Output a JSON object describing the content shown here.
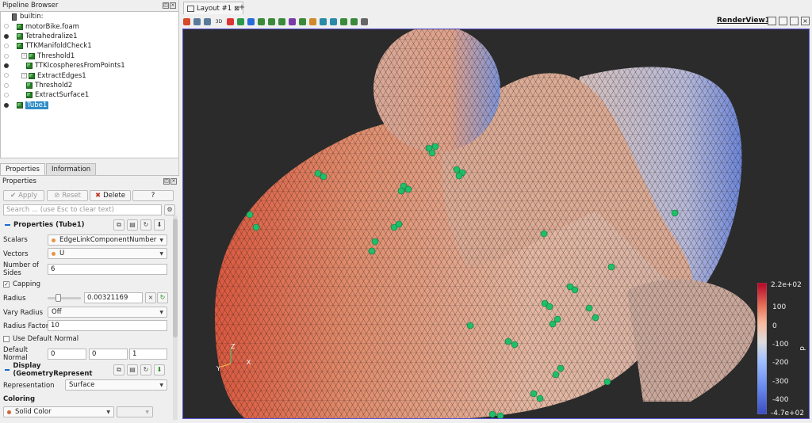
{
  "pipeline_browser": {
    "title": "Pipeline Browser",
    "items": [
      {
        "label": "builtin:",
        "level": 0,
        "kind": "server",
        "eye": "none",
        "expand": ""
      },
      {
        "label": "motorBike.foam",
        "level": 1,
        "kind": "source",
        "eye": "off",
        "expand": ""
      },
      {
        "label": "Tetrahedralize1",
        "level": 1,
        "kind": "source",
        "eye": "on",
        "expand": ""
      },
      {
        "label": "TTKManifoldCheck1",
        "level": 1,
        "kind": "source",
        "eye": "off",
        "expand": ""
      },
      {
        "label": "Threshold1",
        "level": 2,
        "kind": "source",
        "eye": "off",
        "expand": "-"
      },
      {
        "label": "TTKIcospheresFromPoints1",
        "level": 3,
        "kind": "source",
        "eye": "on",
        "expand": ""
      },
      {
        "label": "ExtractEdges1",
        "level": 2,
        "kind": "source",
        "eye": "off",
        "expand": "-"
      },
      {
        "label": "Threshold2",
        "level": 3,
        "kind": "source",
        "eye": "off",
        "expand": ""
      },
      {
        "label": "ExtractSurface1",
        "level": 3,
        "kind": "source",
        "eye": "off",
        "expand": ""
      },
      {
        "label": "Tube1",
        "level": 1,
        "kind": "source",
        "eye": "on",
        "expand": "",
        "selected": true
      }
    ]
  },
  "tabs": [
    {
      "label": "Properties",
      "active": true
    },
    {
      "label": "Information",
      "active": false
    }
  ],
  "properties": {
    "title": "Properties",
    "apply_label": "Apply",
    "reset_label": "Reset",
    "delete_label": "Delete",
    "help_label": "?",
    "search_placeholder": "Search ... (use Esc to clear text)",
    "section_properties": "Properties (Tube1)",
    "scalars_label": "Scalars",
    "scalars_value": "EdgeLinkComponentNumber",
    "vectors_label": "Vectors",
    "vectors_value": "U",
    "sides_label": "Number of Sides",
    "sides_value": "6",
    "capping_label": "Capping",
    "capping_checked": true,
    "radius_label": "Radius",
    "radius_value": "0.00321169",
    "vary_radius_label": "Vary Radius",
    "vary_radius_value": "Off",
    "radius_factor_label": "Radius Factor",
    "radius_factor_value": "10",
    "use_default_normal_label": "Use Default Normal",
    "use_default_normal_checked": false,
    "default_normal_label": "Default Normal",
    "default_normal_values": [
      "0",
      "0",
      "1"
    ],
    "section_display": "Display (GeometryRepresent",
    "representation_label": "Representation",
    "representation_value": "Surface",
    "coloring_label": "Coloring",
    "coloring_value": "Solid Color"
  },
  "layout": {
    "tab_label": "Layout #1",
    "add_tab_label": "+",
    "view_label": "RenderView1",
    "toolbar_icons": [
      "reset-camera-icon",
      "zoom-data-icon",
      "zoom-closest-icon",
      "3d-toggle-icon",
      "camera-x-icon",
      "camera-y-icon",
      "camera-z-icon",
      "rotate-icon",
      "select-cells-icon",
      "select-points-icon",
      "select-frustum-icon",
      "select-block-icon",
      "interactive-select-icon",
      "hover-points-icon",
      "hover-cells-icon",
      "grow-selection-icon",
      "shrink-selection-icon",
      "clear-selection-icon"
    ],
    "toolbar_3d_label": "3D"
  },
  "axes": {
    "z": "Z",
    "y": "Y",
    "x": "X"
  },
  "color_legend": {
    "title": "p",
    "max_label": "2.2e+02",
    "min_label": "-4.7e+02",
    "tick_labels": [
      "100",
      "0",
      "-100",
      "-200",
      "-300",
      "-400"
    ],
    "colors": [
      "#b40426",
      "#e7745b",
      "#f7b89c",
      "#dddcdc",
      "#9ebeff",
      "#6788ee",
      "#3b4cc0"
    ]
  }
}
